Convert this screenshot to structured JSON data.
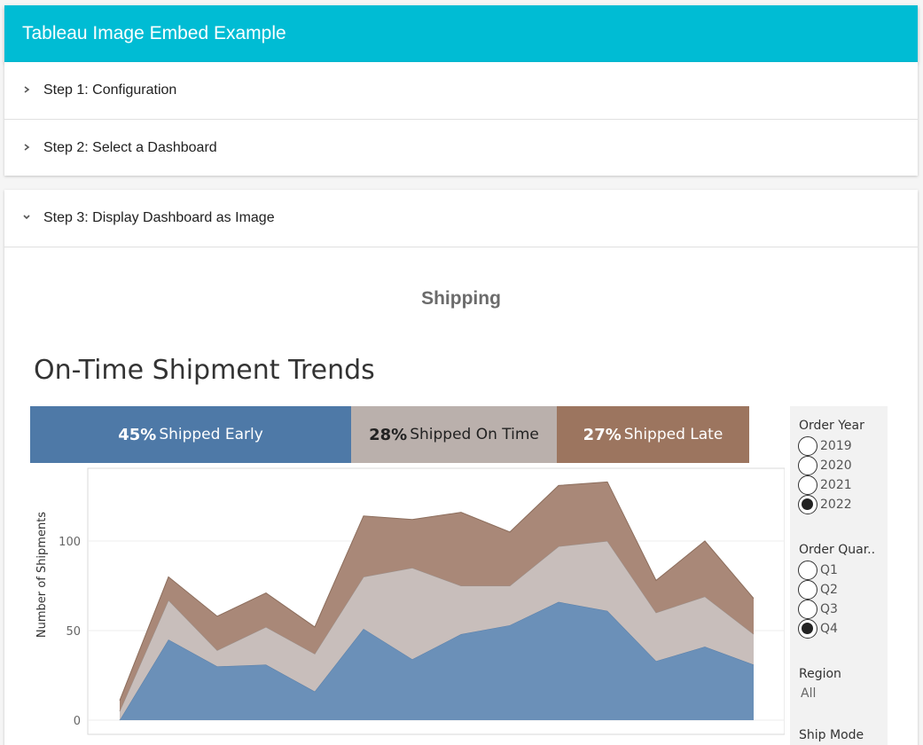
{
  "app": {
    "title": "Tableau Image Embed Example"
  },
  "steps": [
    {
      "label": "Step 1: Configuration",
      "expanded": false
    },
    {
      "label": "Step 2: Select a Dashboard",
      "expanded": false
    },
    {
      "label": "Step 3: Display Dashboard as Image",
      "expanded": true
    }
  ],
  "dashboard": {
    "title": "Shipping",
    "viz_title": "On-Time Shipment Trends",
    "summary": [
      {
        "pct": "45%",
        "label": "Shipped Early",
        "color": "#4e79a7"
      },
      {
        "pct": "28%",
        "label": "Shipped On Time",
        "color": "#bab0ac"
      },
      {
        "pct": "27%",
        "label": "Shipped Late",
        "color": "#9c755f"
      }
    ]
  },
  "filters": {
    "order_year": {
      "title": "Order Year",
      "options": [
        "2019",
        "2020",
        "2021",
        "2022"
      ],
      "selected": "2022"
    },
    "order_quarter": {
      "title": "Order Quar..",
      "options": [
        "Q1",
        "Q2",
        "Q3",
        "Q4"
      ],
      "selected": "Q4"
    },
    "region": {
      "title": "Region",
      "value": "All"
    },
    "ship_mode": {
      "title": "Ship Mode"
    }
  },
  "chart_data": {
    "type": "area",
    "stacked": true,
    "ylabel": "Number of Shipments",
    "ylim": [
      0,
      135
    ],
    "yticks": [
      0,
      50,
      100
    ],
    "grid": true,
    "x_points": 15,
    "series": [
      {
        "name": "Shipped Early",
        "color": "#6b90b8",
        "values": [
          0,
          45,
          30,
          31,
          16,
          51,
          34,
          48,
          53,
          66,
          61,
          33,
          41,
          31
        ]
      },
      {
        "name": "Shipped On Time",
        "color": "#c8bebb",
        "values": [
          5,
          22,
          9,
          21,
          21,
          29,
          51,
          27,
          22,
          31,
          39,
          27,
          28,
          17
        ]
      },
      {
        "name": "Shipped Late",
        "color": "#a98878",
        "values": [
          6,
          13,
          19,
          19,
          15,
          34,
          27,
          41,
          30,
          34,
          33,
          18,
          31,
          20
        ]
      }
    ]
  }
}
